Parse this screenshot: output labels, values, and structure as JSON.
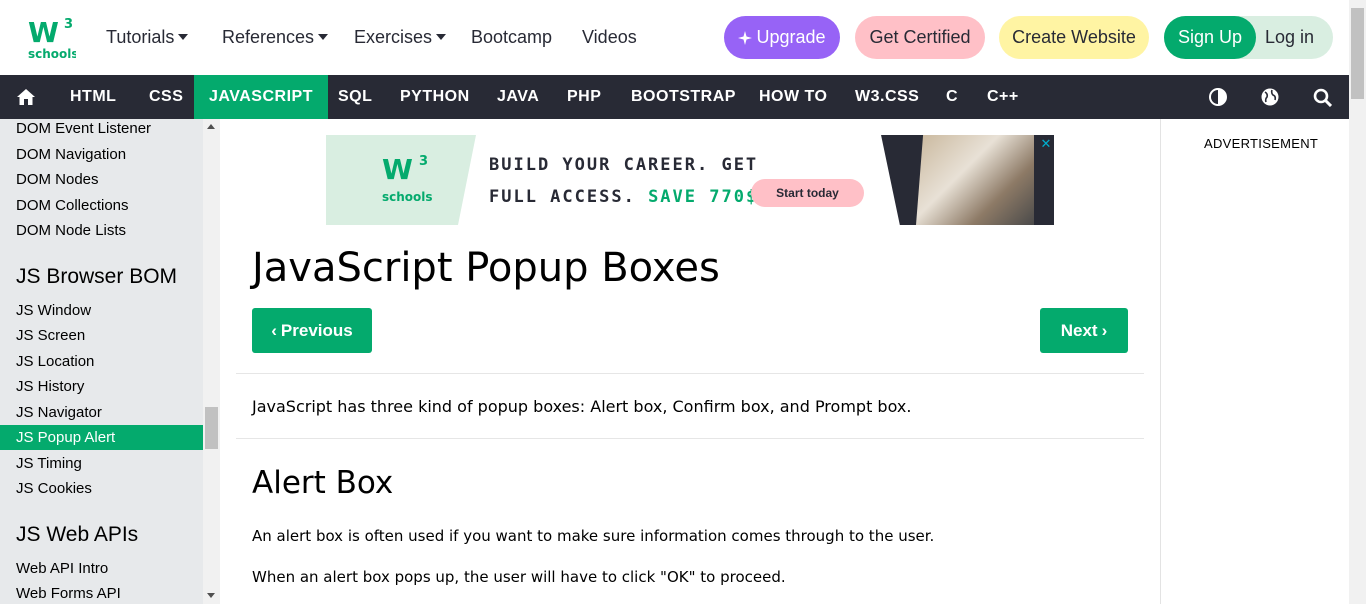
{
  "topnav": {
    "logo_text": "schools",
    "logo_mark": "W",
    "logo_sup": "3",
    "tutorials": "Tutorials",
    "references": "References",
    "exercises": "Exercises",
    "bootcamp": "Bootcamp",
    "videos": "Videos",
    "upgrade": "Upgrade",
    "get_certified": "Get Certified",
    "create_website": "Create Website",
    "sign_up": "Sign Up",
    "log_in": "Log in"
  },
  "darknav": {
    "items": [
      "HTML",
      "CSS",
      "JAVASCRIPT",
      "SQL",
      "PYTHON",
      "JAVA",
      "PHP",
      "BOOTSTRAP",
      "HOW TO",
      "W3.CSS",
      "C",
      "C++"
    ],
    "active": "JAVASCRIPT",
    "icons": [
      "home-icon",
      "contrast-icon",
      "globe-icon",
      "search-icon"
    ]
  },
  "sidebar": {
    "links_a": [
      "DOM Event Listener",
      "DOM Navigation",
      "DOM Nodes",
      "DOM Collections",
      "DOM Node Lists"
    ],
    "heading_bom": "JS Browser BOM",
    "links_b": [
      "JS Window",
      "JS Screen",
      "JS Location",
      "JS History",
      "JS Navigator",
      "JS Popup Alert",
      "JS Timing",
      "JS Cookies"
    ],
    "active": "JS Popup Alert",
    "heading_web": "JS Web APIs",
    "links_c": [
      "Web API Intro",
      "Web Forms API"
    ]
  },
  "banner": {
    "logo_text": "schools",
    "line1": "BUILD YOUR CAREER. GET",
    "line2": "FULL ACCESS. ",
    "line2_green": "SAVE 770$",
    "button": "Start today"
  },
  "main": {
    "title": "JavaScript Popup Boxes",
    "prev": "Previous",
    "next": "Next",
    "intro": "JavaScript has three kind of popup boxes: Alert box, Confirm box, and Prompt box.",
    "h2": "Alert Box",
    "p1": "An alert box is often used if you want to make sure information comes through to the user.",
    "p2": "When an alert box pops up, the user will have to click \"OK\" to proceed."
  },
  "right": {
    "ad_label": "ADVERTISEMENT"
  },
  "colors": {
    "green": "#04aa6d",
    "dark": "#282a35",
    "purple": "#9763f6",
    "pink": "#ffc0c7",
    "yellow": "#fff4a3",
    "mint": "#d9eee1"
  }
}
